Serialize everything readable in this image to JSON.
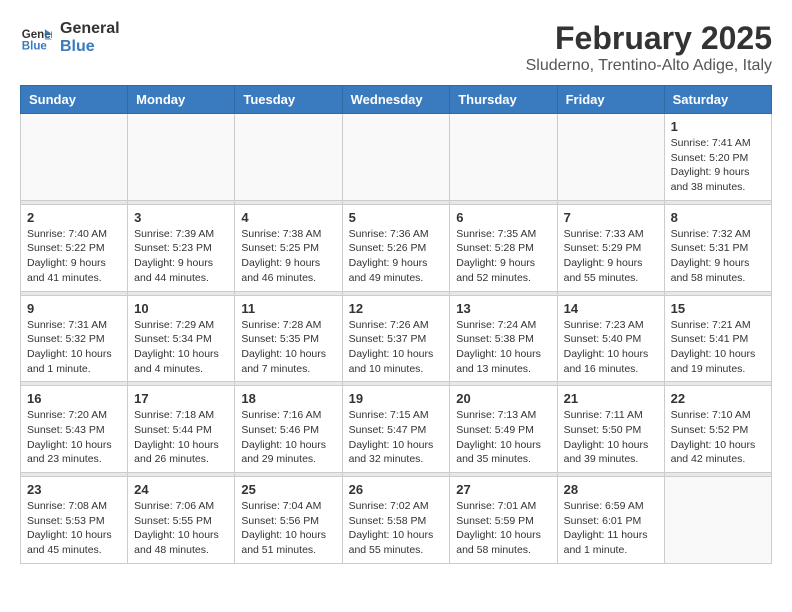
{
  "header": {
    "logo_line1": "General",
    "logo_line2": "Blue",
    "title": "February 2025",
    "subtitle": "Sluderno, Trentino-Alto Adige, Italy"
  },
  "days_of_week": [
    "Sunday",
    "Monday",
    "Tuesday",
    "Wednesday",
    "Thursday",
    "Friday",
    "Saturday"
  ],
  "weeks": [
    {
      "days": [
        {
          "num": "",
          "info": ""
        },
        {
          "num": "",
          "info": ""
        },
        {
          "num": "",
          "info": ""
        },
        {
          "num": "",
          "info": ""
        },
        {
          "num": "",
          "info": ""
        },
        {
          "num": "",
          "info": ""
        },
        {
          "num": "1",
          "info": "Sunrise: 7:41 AM\nSunset: 5:20 PM\nDaylight: 9 hours and 38 minutes."
        }
      ]
    },
    {
      "days": [
        {
          "num": "2",
          "info": "Sunrise: 7:40 AM\nSunset: 5:22 PM\nDaylight: 9 hours and 41 minutes."
        },
        {
          "num": "3",
          "info": "Sunrise: 7:39 AM\nSunset: 5:23 PM\nDaylight: 9 hours and 44 minutes."
        },
        {
          "num": "4",
          "info": "Sunrise: 7:38 AM\nSunset: 5:25 PM\nDaylight: 9 hours and 46 minutes."
        },
        {
          "num": "5",
          "info": "Sunrise: 7:36 AM\nSunset: 5:26 PM\nDaylight: 9 hours and 49 minutes."
        },
        {
          "num": "6",
          "info": "Sunrise: 7:35 AM\nSunset: 5:28 PM\nDaylight: 9 hours and 52 minutes."
        },
        {
          "num": "7",
          "info": "Sunrise: 7:33 AM\nSunset: 5:29 PM\nDaylight: 9 hours and 55 minutes."
        },
        {
          "num": "8",
          "info": "Sunrise: 7:32 AM\nSunset: 5:31 PM\nDaylight: 9 hours and 58 minutes."
        }
      ]
    },
    {
      "days": [
        {
          "num": "9",
          "info": "Sunrise: 7:31 AM\nSunset: 5:32 PM\nDaylight: 10 hours and 1 minute."
        },
        {
          "num": "10",
          "info": "Sunrise: 7:29 AM\nSunset: 5:34 PM\nDaylight: 10 hours and 4 minutes."
        },
        {
          "num": "11",
          "info": "Sunrise: 7:28 AM\nSunset: 5:35 PM\nDaylight: 10 hours and 7 minutes."
        },
        {
          "num": "12",
          "info": "Sunrise: 7:26 AM\nSunset: 5:37 PM\nDaylight: 10 hours and 10 minutes."
        },
        {
          "num": "13",
          "info": "Sunrise: 7:24 AM\nSunset: 5:38 PM\nDaylight: 10 hours and 13 minutes."
        },
        {
          "num": "14",
          "info": "Sunrise: 7:23 AM\nSunset: 5:40 PM\nDaylight: 10 hours and 16 minutes."
        },
        {
          "num": "15",
          "info": "Sunrise: 7:21 AM\nSunset: 5:41 PM\nDaylight: 10 hours and 19 minutes."
        }
      ]
    },
    {
      "days": [
        {
          "num": "16",
          "info": "Sunrise: 7:20 AM\nSunset: 5:43 PM\nDaylight: 10 hours and 23 minutes."
        },
        {
          "num": "17",
          "info": "Sunrise: 7:18 AM\nSunset: 5:44 PM\nDaylight: 10 hours and 26 minutes."
        },
        {
          "num": "18",
          "info": "Sunrise: 7:16 AM\nSunset: 5:46 PM\nDaylight: 10 hours and 29 minutes."
        },
        {
          "num": "19",
          "info": "Sunrise: 7:15 AM\nSunset: 5:47 PM\nDaylight: 10 hours and 32 minutes."
        },
        {
          "num": "20",
          "info": "Sunrise: 7:13 AM\nSunset: 5:49 PM\nDaylight: 10 hours and 35 minutes."
        },
        {
          "num": "21",
          "info": "Sunrise: 7:11 AM\nSunset: 5:50 PM\nDaylight: 10 hours and 39 minutes."
        },
        {
          "num": "22",
          "info": "Sunrise: 7:10 AM\nSunset: 5:52 PM\nDaylight: 10 hours and 42 minutes."
        }
      ]
    },
    {
      "days": [
        {
          "num": "23",
          "info": "Sunrise: 7:08 AM\nSunset: 5:53 PM\nDaylight: 10 hours and 45 minutes."
        },
        {
          "num": "24",
          "info": "Sunrise: 7:06 AM\nSunset: 5:55 PM\nDaylight: 10 hours and 48 minutes."
        },
        {
          "num": "25",
          "info": "Sunrise: 7:04 AM\nSunset: 5:56 PM\nDaylight: 10 hours and 51 minutes."
        },
        {
          "num": "26",
          "info": "Sunrise: 7:02 AM\nSunset: 5:58 PM\nDaylight: 10 hours and 55 minutes."
        },
        {
          "num": "27",
          "info": "Sunrise: 7:01 AM\nSunset: 5:59 PM\nDaylight: 10 hours and 58 minutes."
        },
        {
          "num": "28",
          "info": "Sunrise: 6:59 AM\nSunset: 6:01 PM\nDaylight: 11 hours and 1 minute."
        },
        {
          "num": "",
          "info": ""
        }
      ]
    }
  ]
}
